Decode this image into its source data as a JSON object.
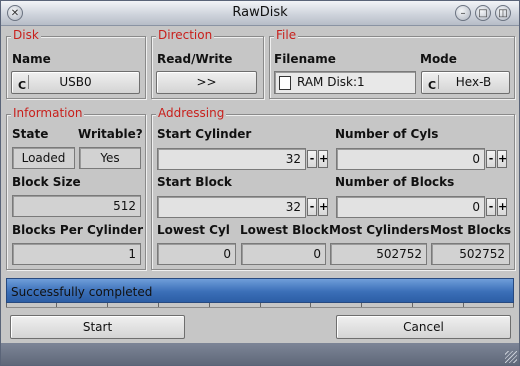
{
  "window": {
    "title": "RawDisk"
  },
  "disk": {
    "group_label": "Disk",
    "name_label": "Name",
    "name_value": "USB0"
  },
  "direction": {
    "group_label": "Direction",
    "rw_label": "Read/Write",
    "rw_value": ">>"
  },
  "file": {
    "group_label": "File",
    "filename_label": "Filename",
    "filename_value": "RAM Disk:1",
    "mode_label": "Mode",
    "mode_value": "Hex-B"
  },
  "information": {
    "group_label": "Information",
    "state_label": "State",
    "state_value": "Loaded",
    "writable_label": "Writable?",
    "writable_value": "Yes",
    "block_size_label": "Block Size",
    "block_size_value": "512",
    "bpc_label": "Blocks Per Cylinder",
    "bpc_value": "1"
  },
  "addressing": {
    "group_label": "Addressing",
    "start_cyl_label": "Start Cylinder",
    "start_cyl_value": "32",
    "num_cyls_label": "Number of Cyls",
    "num_cyls_value": "0",
    "start_block_label": "Start Block",
    "start_block_value": "32",
    "num_blocks_label": "Number of Blocks",
    "num_blocks_value": "0",
    "lowest_cyl_label": "Lowest Cyl",
    "lowest_cyl_value": "0",
    "lowest_block_label": "Lowest Block",
    "lowest_block_value": "0",
    "most_cyls_label": "Most Cylinders",
    "most_cyls_value": "502752",
    "most_blocks_label": "Most Blocks",
    "most_blocks_value": "502752"
  },
  "stepper": {
    "minus": "-",
    "plus": "+"
  },
  "status": {
    "text": "Successfully completed",
    "fill_color": "#3b6fb8"
  },
  "actions": {
    "start_label": "Start",
    "cancel_label": "Cancel"
  },
  "icons": {
    "close": "close-icon",
    "minimize": "minimize-icon",
    "zoom": "zoom-icon",
    "depth": "depth-icon",
    "cycle": "cycle-gadget-icon",
    "file": "file-icon"
  }
}
